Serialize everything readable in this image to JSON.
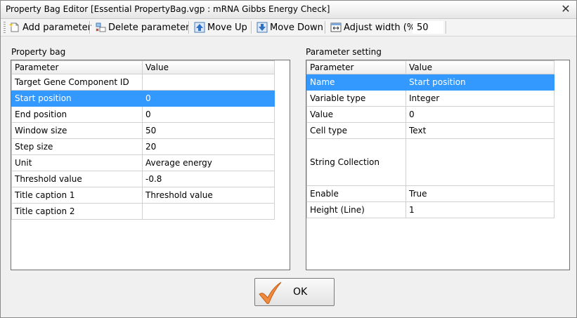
{
  "window": {
    "title": "Property Bag Editor   [Essential PropertyBag.vgp : mRNA Gibbs Energy Check]",
    "close_glyph": "✕"
  },
  "toolbar": {
    "add_label": "Add parameter",
    "delete_label": "Delete parameter",
    "move_up_label": "Move Up",
    "move_down_label": "Move Down",
    "adjust_width_label": "Adjust width (%)",
    "adjust_width_value": "50",
    "icons": [
      "add-parameter-icon",
      "delete-parameter-icon",
      "move-up-icon",
      "move-down-icon",
      "adjust-width-icon"
    ]
  },
  "property_bag": {
    "label": "Property bag",
    "columns": [
      "Parameter",
      "Value"
    ],
    "rows": [
      {
        "parameter": "Target Gene Component ID",
        "value": ""
      },
      {
        "parameter": "Start position",
        "value": "0",
        "selected": true
      },
      {
        "parameter": "End position",
        "value": "0"
      },
      {
        "parameter": "Window size",
        "value": "50"
      },
      {
        "parameter": "Step size",
        "value": "20"
      },
      {
        "parameter": "Unit",
        "value": "Average energy"
      },
      {
        "parameter": "Threshold value",
        "value": "-0.8"
      },
      {
        "parameter": "Title caption 1",
        "value": "Threshold value"
      },
      {
        "parameter": "Title caption 2",
        "value": ""
      }
    ]
  },
  "parameter_setting": {
    "label": "Parameter setting",
    "columns": [
      "Parameter",
      "Value"
    ],
    "rows": [
      {
        "parameter": "Name",
        "value": "Start position",
        "selected": true
      },
      {
        "parameter": "Variable type",
        "value": "Integer"
      },
      {
        "parameter": "Value",
        "value": "0"
      },
      {
        "parameter": "Cell type",
        "value": "Text"
      },
      {
        "parameter": "String Collection",
        "value": "",
        "tall": true
      },
      {
        "parameter": "Enable",
        "value": "True"
      },
      {
        "parameter": "Height (Line)",
        "value": "1"
      }
    ]
  },
  "ok_button": {
    "label": "OK"
  },
  "colors": {
    "selection": "#3399ff",
    "check_icon": "#f08a3c"
  }
}
